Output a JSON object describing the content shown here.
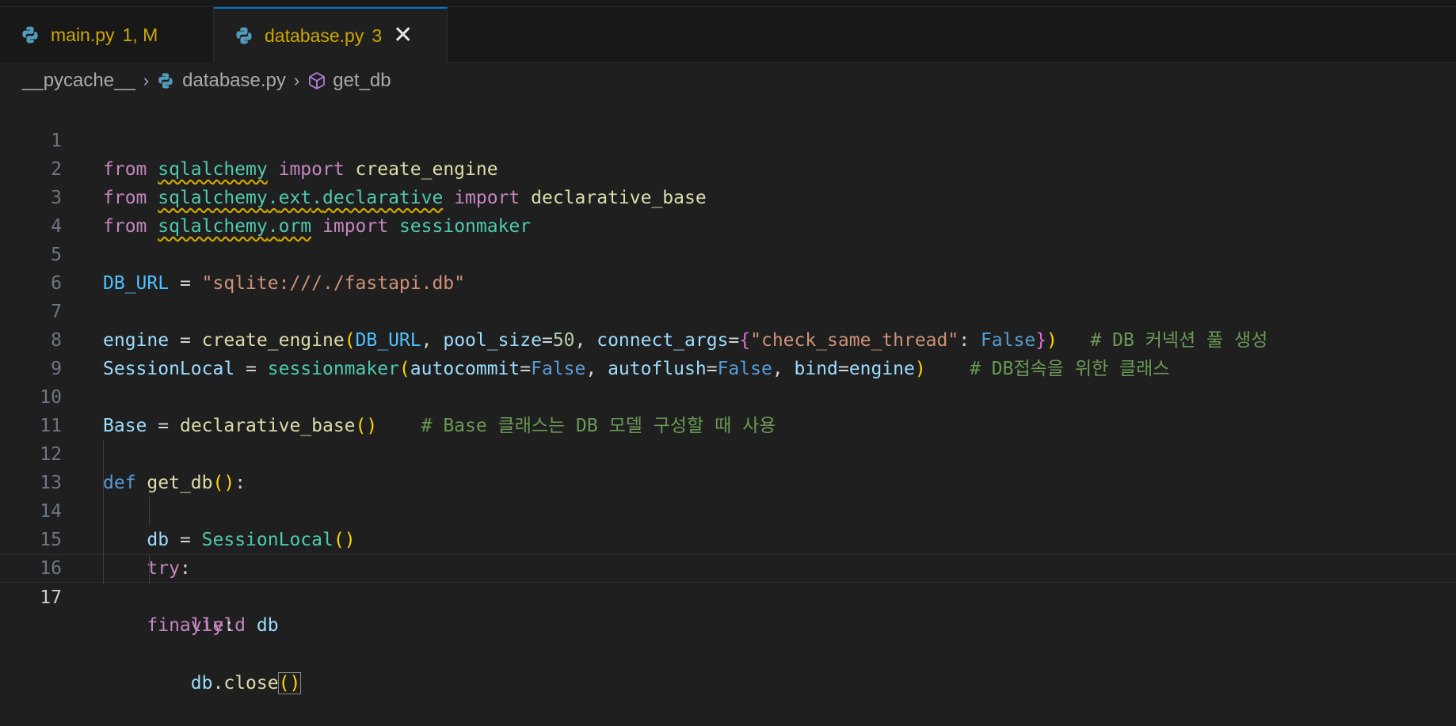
{
  "tabs": [
    {
      "name": "main.py",
      "badge": "1, M"
    },
    {
      "name": "database.py",
      "badge": "3",
      "close": "✕"
    }
  ],
  "breadcrumb": {
    "folder": "__pycache__",
    "file": "database.py",
    "symbol": "get_db",
    "sep": "›"
  },
  "line_numbers": [
    "1",
    "2",
    "3",
    "4",
    "5",
    "6",
    "7",
    "8",
    "9",
    "10",
    "11",
    "12",
    "13",
    "14",
    "15",
    "16",
    "17"
  ],
  "tokens": {
    "from": "from",
    "import": "import",
    "def": "def",
    "try": "try",
    "yield": "yield",
    "finally": "finally",
    "sqlalchemy": "sqlalchemy",
    "ext": "ext",
    "declarative": "declarative",
    "orm": "orm",
    "create_engine": "create_engine",
    "declarative_base": "declarative_base",
    "sessionmaker": "sessionmaker",
    "DB_URL": "DB_URL",
    "db_url_str": "\"sqlite:///./fastapi.db\"",
    "engine": "engine",
    "pool_size": "pool_size",
    "fifty": "50",
    "connect_args": "connect_args",
    "check_same_thread": "\"check_same_thread\"",
    "False": "False",
    "comment1": "# DB 커넥션 풀 생성",
    "SessionLocal": "SessionLocal",
    "autocommit": "autocommit",
    "autoflush": "autoflush",
    "bind": "bind",
    "comment2": "# DB접속을 위한 클래스",
    "Base": "Base",
    "comment3": "# Base 클래스는 DB 모델 구성할 때 사용",
    "get_db": "get_db",
    "db": "db",
    "close": "close"
  }
}
